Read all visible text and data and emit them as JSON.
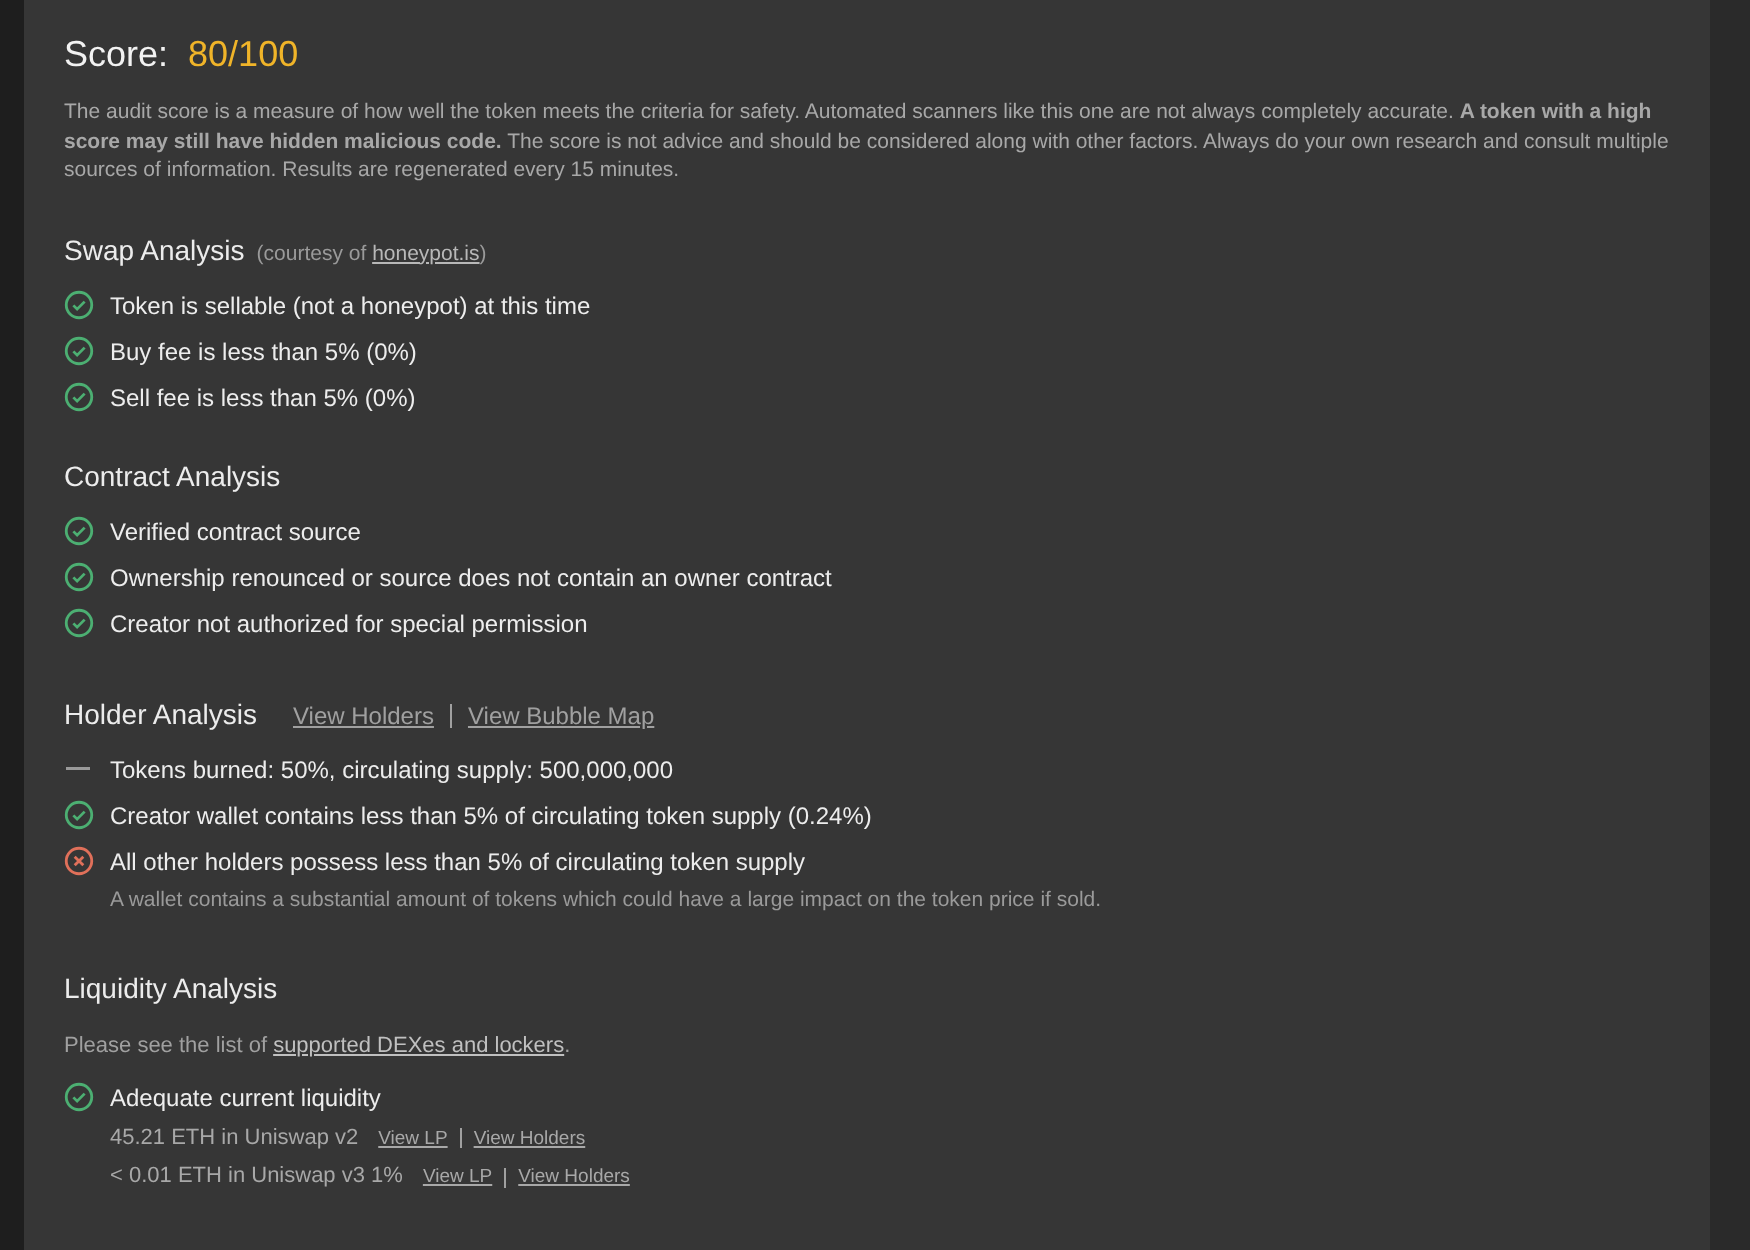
{
  "score": {
    "label": "Score:",
    "value": "80/100"
  },
  "description": "The audit score is a measure of how well the token meets the criteria for safety.  Automated scanners like this one are not always completely accurate.  **A token with a high score may still have hidden malicious code.** The score is not advice and should be considered along with other factors. Always do your own research and consult multiple sources of information.  Results are regenerated every 15 minutes.",
  "sections": [
    {
      "title": "Swap Analysis",
      "note": {
        "before": "(courtesy of ",
        "link": "honeypot.is",
        "after": ")"
      },
      "items": [
        {
          "kind": "pass",
          "text": "Token is sellable (not a honeypot) at this time"
        },
        {
          "kind": "pass",
          "text": "Buy fee is less than 5% (0%)"
        },
        {
          "kind": "pass",
          "text": "Sell fee is less than 5% (0%)"
        }
      ]
    },
    {
      "title": "Contract Analysis",
      "items": [
        {
          "kind": "pass",
          "text": "Verified contract source"
        },
        {
          "kind": "pass",
          "text": "Ownership renounced or source does not contain an owner contract"
        },
        {
          "kind": "pass",
          "text": "Creator not authorized for special permission"
        }
      ]
    },
    {
      "title": "Holder Analysis",
      "links": [
        "View Holders",
        "View Bubble Map"
      ],
      "items": [
        {
          "kind": "info",
          "text": "Tokens burned: 50%, circulating supply: 500,000,000"
        },
        {
          "kind": "pass",
          "text": "Creator wallet contains less than 5% of circulating token supply (0.24%)"
        },
        {
          "kind": "fail",
          "text": "All other holders possess less than 5% of circulating token supply",
          "detail": "A wallet contains a substantial amount of tokens which could have a large impact on the token price if sold."
        }
      ]
    },
    {
      "title": "Liquidity Analysis",
      "intro": {
        "before": "Please see the list of ",
        "link": "supported DEXes and lockers",
        "after": "."
      },
      "items": [
        {
          "kind": "pass",
          "text": "Adequate current liquidity",
          "pools": [
            {
              "text": "45.21 ETH in Uniswap v2",
              "links": [
                "View LP",
                "View Holders"
              ]
            },
            {
              "text": "< 0.01 ETH in Uniswap v3 1%",
              "links": [
                "View LP",
                "View Holders"
              ]
            }
          ]
        }
      ]
    }
  ]
}
